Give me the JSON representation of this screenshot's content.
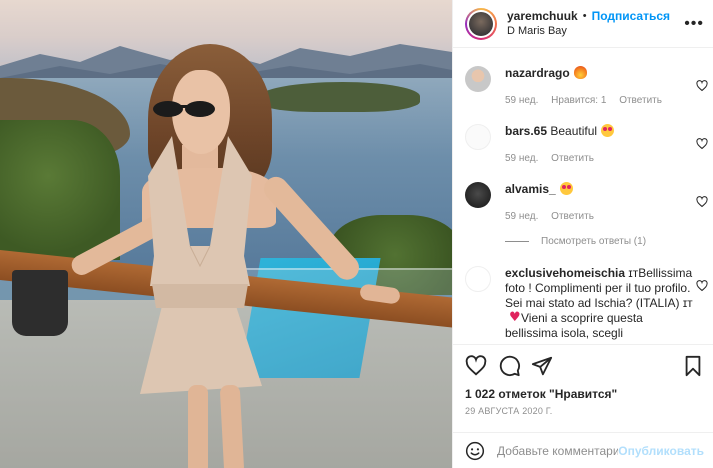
{
  "header": {
    "username": "yaremchuuk",
    "separator": "•",
    "follow_label": "Подписаться",
    "location": "D Maris Bay"
  },
  "comments": [
    {
      "username": "nazardrago",
      "text": "",
      "emoji": "fire-emoji",
      "age": "59 нед.",
      "likes": "Нравится: 1",
      "reply": "Ответить"
    },
    {
      "username": "bars.65",
      "text": "Beautiful",
      "emoji": "heart-eyes-emoji",
      "age": "59 нед.",
      "reply": "Ответить"
    },
    {
      "username": "alvamis_",
      "text": "",
      "emoji": "heart-eyes-emoji",
      "age": "59 нед.",
      "reply": "Ответить"
    },
    {
      "username": "exclusivehomeischia",
      "text": "ɪᴛBellissima foto ! Complimenti per il tuo profilo. Sei mai stato ad Ischia? (ITALIA) ɪᴛ",
      "text_after_emoji": "Vieni a scoprire questa bellissima isola, scegli",
      "emoji": "red-heart-emoji"
    }
  ],
  "view_replies": "Посмотреть ответы (1)",
  "likes_text": "1 022 отметок \"Нравится\"",
  "date": "29 АВГУСТА 2020 Г.",
  "comment_box": {
    "placeholder": "Добавьте комментарий...",
    "publish_label": "Опубликовать"
  },
  "colors": {
    "accent": "#0095f6",
    "publish_disabled": "#b2dffc",
    "muted_text": "#8e8e8e",
    "text": "#262626"
  }
}
